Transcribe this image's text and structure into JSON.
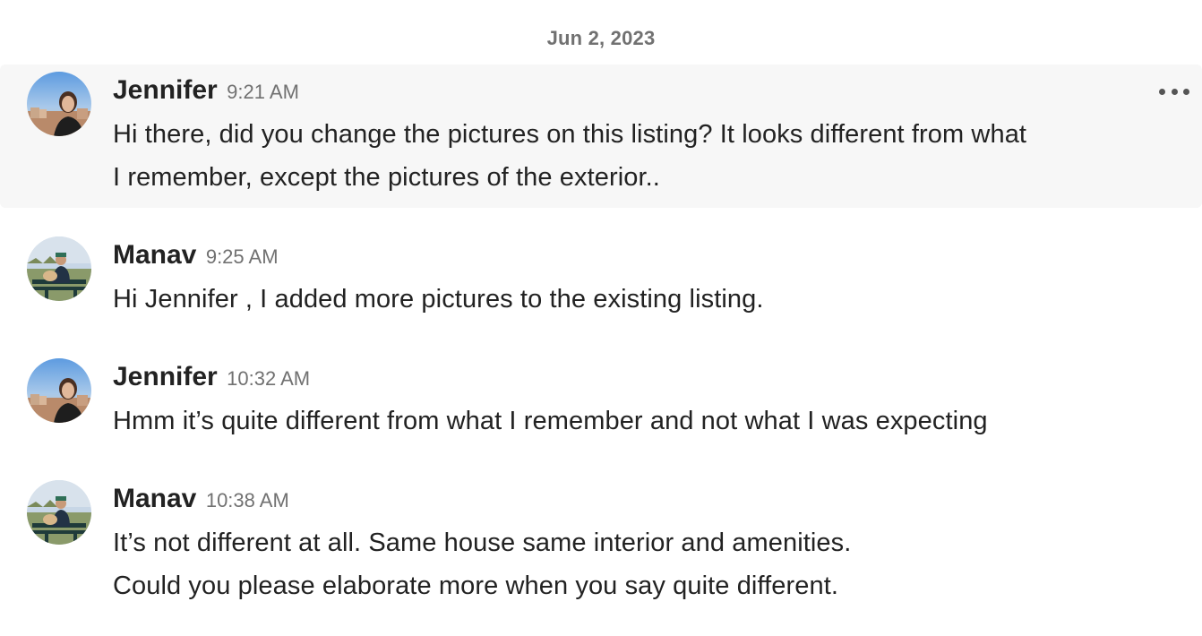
{
  "date_divider": "Jun 2, 2023",
  "messages": [
    {
      "sender": "Jennifer",
      "time": "9:21 AM",
      "avatar": "jennifer-avatar",
      "highlighted": true,
      "lines": [
        "Hi there, did you change the pictures on this listing? It looks different from what",
        "I remember, except the pictures of the exterior.."
      ]
    },
    {
      "sender": "Manav",
      "time": "9:25 AM",
      "avatar": "manav-avatar",
      "highlighted": false,
      "lines": [
        "Hi Jennifer , I added more pictures to the existing listing."
      ]
    },
    {
      "sender": "Jennifer",
      "time": "10:32 AM",
      "avatar": "jennifer-avatar",
      "highlighted": false,
      "lines": [
        "Hmm it’s quite different from what I remember and not what I was expecting"
      ]
    },
    {
      "sender": "Manav",
      "time": "10:38 AM",
      "avatar": "manav-avatar",
      "highlighted": false,
      "lines": [
        "It’s not different at all. Same house same interior and amenities.",
        "Could you please elaborate more when you say quite different."
      ]
    }
  ],
  "more_options_icon": "more-horizontal-icon",
  "colors": {
    "text": "#222222",
    "muted": "#717171",
    "highlight_bg": "#f7f7f7"
  }
}
